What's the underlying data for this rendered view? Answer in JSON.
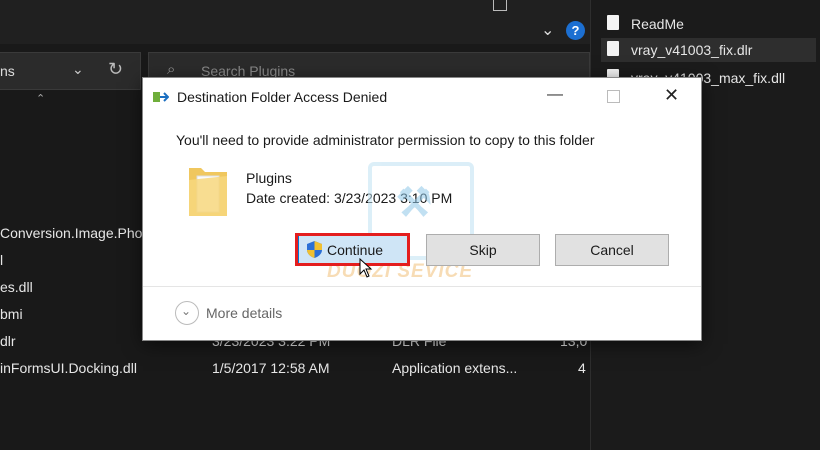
{
  "explorer": {
    "address_text": "ns",
    "search_placeholder": "Search Plugins",
    "help_label": "?",
    "rows": [
      {
        "name": "Conversion.Image.Pho",
        "date": "",
        "type": "",
        "size": ""
      },
      {
        "name": "l",
        "date": "",
        "type": "",
        "size": ""
      },
      {
        "name": "es.dll",
        "date": "",
        "type": "",
        "size": ""
      },
      {
        "name": "bmi",
        "date": "",
        "type": "",
        "size": ""
      },
      {
        "name": "dlr",
        "date": "3/23/2023 3:22 PM",
        "type": "DLR File",
        "size": "13,0"
      },
      {
        "name": "inFormsUI.Docking.dll",
        "date": "1/5/2017 12:58 AM",
        "type": "Application extens...",
        "size": "4"
      }
    ]
  },
  "right_pane": {
    "items": [
      {
        "label": "ReadMe",
        "selected": false
      },
      {
        "label": "vray_v41003_fix.dlr",
        "selected": true
      },
      {
        "label": "vray_v41003_max_fix.dll",
        "selected": false
      }
    ]
  },
  "dialog": {
    "title": "Destination Folder Access Denied",
    "message": "You'll need to provide administrator permission to copy to this folder",
    "folder_name": "Plugins",
    "folder_date": "Date created: 3/23/2023 3:10 PM",
    "buttons": {
      "continue": "Continue",
      "skip": "Skip",
      "cancel": "Cancel"
    },
    "more_details": "More details",
    "watermark_text": "DUOZI SEVICE"
  },
  "colors": {
    "highlight": "#e41e1e",
    "accent": "#0078d7",
    "help": "#1c6fd1"
  }
}
